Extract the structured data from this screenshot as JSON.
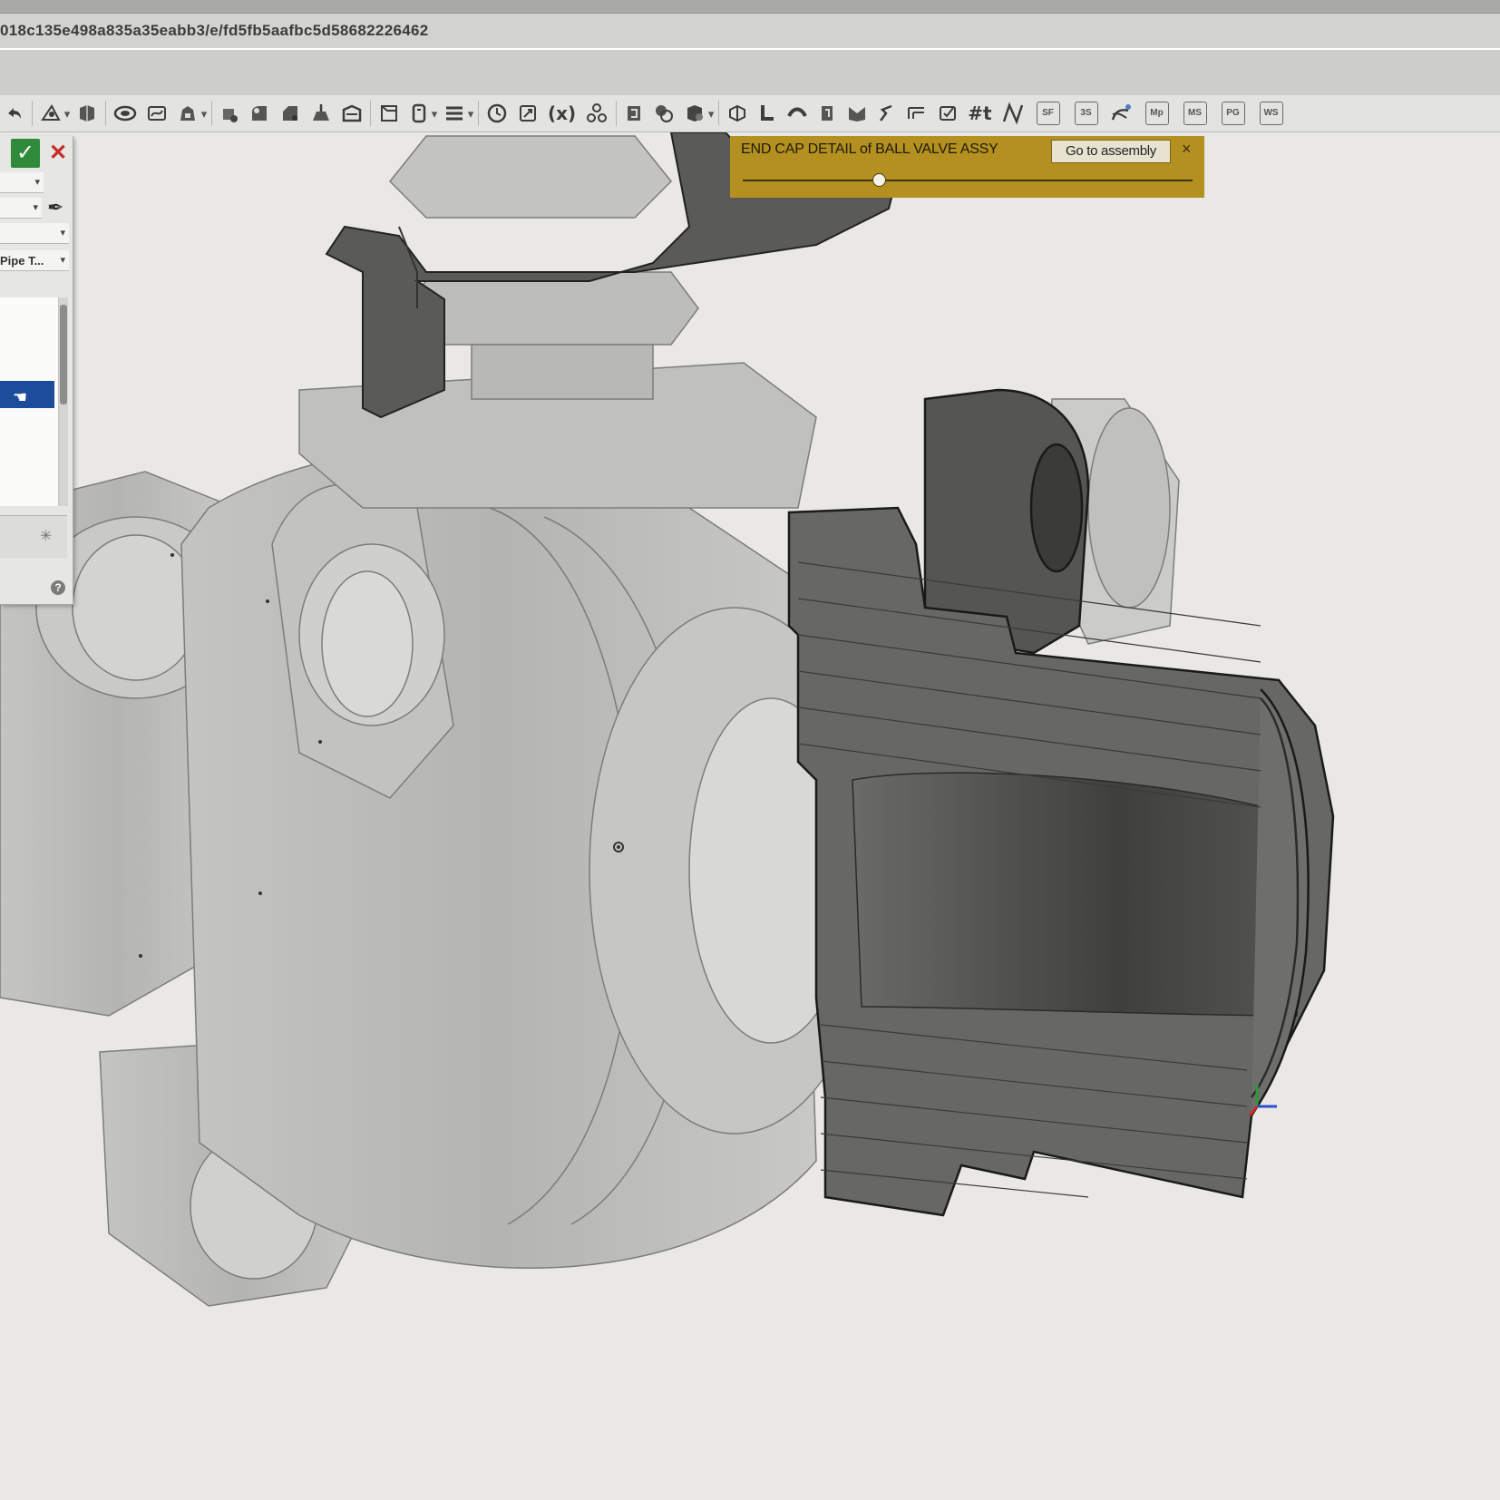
{
  "browser": {
    "url": "018c135e498a835a35eabb3/e/fd5fb5aafbc5d58682226462"
  },
  "toolbar": {
    "icons": [
      "sketch-icon",
      "extrude-icon",
      "revolve-icon",
      "sweep-icon",
      "loft-icon",
      "thicken-icon",
      "fillet-icon",
      "chamfer-icon",
      "draft-icon",
      "shell-icon",
      "rib-icon",
      "hole-icon",
      "plane-icon",
      "pattern-icon",
      "mirror-icon",
      "helix-icon",
      "transform-icon",
      "variable-icon",
      "boolean-icon",
      "split-icon",
      "replace-face-icon",
      "move-face-icon",
      "delete-face-icon",
      "sheet-metal-icon",
      "flange-icon",
      "hem-icon",
      "tab-icon",
      "joint-icon",
      "bend-icon",
      "form-icon",
      "finish-icon"
    ],
    "variable_label": "(x)",
    "hash_label": "#t",
    "curve_label": "ℵ",
    "square_labels": [
      "SF",
      "3S",
      "Mp",
      "MS",
      "PG",
      "WS"
    ]
  },
  "dialog": {
    "confirm_icon": "checkmark-icon",
    "cancel_icon": "close-icon",
    "dropdown_value": "Pipe T...",
    "help_label": "?"
  },
  "banner": {
    "title": "END CAP DETAIL of BALL VALVE ASSY",
    "button": "Go to assembly",
    "close": "×",
    "slider_position": 0.3
  },
  "colors": {
    "banner": "#b3901f",
    "confirm": "#2f8a3c",
    "cancel": "#c72b2b",
    "selection": "#1d4c9c",
    "viewport_bg": "#e9e8e4",
    "part_dark": "#5f5f5e",
    "part_ghost": "#bcbcba"
  }
}
